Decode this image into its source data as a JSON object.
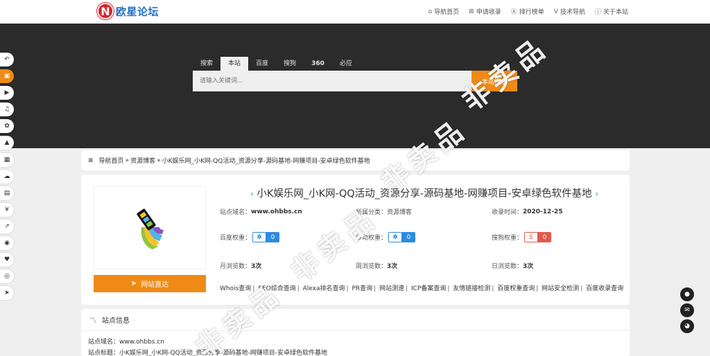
{
  "header": {
    "logo_mark": "N",
    "logo_text": "欧星论坛",
    "nav": [
      {
        "icon": "home-icon",
        "glyph": "⌂",
        "label": "导航首页"
      },
      {
        "icon": "plus-square-icon",
        "glyph": "⊞",
        "label": "申请收录"
      },
      {
        "icon": "ranking-icon",
        "glyph": "Ⓐ",
        "label": "排行榜单"
      },
      {
        "icon": "v-icon",
        "glyph": "V",
        "label": "技术导航"
      },
      {
        "icon": "info-icon",
        "glyph": "ⓘ",
        "label": "关于本站"
      }
    ]
  },
  "search": {
    "tabs": [
      "搜索",
      "本站",
      "百度",
      "搜狗",
      "360",
      "必应"
    ],
    "active_tab": 1,
    "placeholder": "请输入关键词...",
    "button_label": "本站搜索"
  },
  "breadcrumb": {
    "icon": "≡",
    "items": [
      "导航首页",
      "资源博客",
      "小K娱乐网_小K网-QQ活动_资源分享-源码基地-网赚项目-安卓绿色软件基地"
    ],
    "separator": "»"
  },
  "site": {
    "title": "小K娱乐网_小K网-QQ活动_资源分享-源码基地-网赚项目-安卓绿色软件基地",
    "visit_label": "网站直达",
    "domain_label": "站点域名：",
    "domain": "www.ohbbs.cn",
    "category_label": "所属分类：",
    "category": "资源博客",
    "added_label": "收录时间：",
    "added": "2020-12-25",
    "baidu_label": "百度权重：",
    "baidu_value": "0",
    "mobile_label": "移动权重：",
    "mobile_value": "0",
    "sogou_label": "搜狗权重：",
    "sogou_value": "0",
    "monthly_label": "月浏览数：",
    "monthly": "3次",
    "weekly_label": "周浏览数：",
    "weekly": "3次",
    "daily_label": "日浏览数：",
    "daily": "3次",
    "tools": [
      "Whois查询",
      "SEO综合查询",
      "Alexa排名查询",
      "PR查询",
      "网站测速",
      "ICP备案查询",
      "友情链接检测",
      "百度权重查询",
      "网站安全检测",
      "百度收录查询"
    ]
  },
  "info_section": {
    "header": "站点信息",
    "domain_line": "站点域名：www.ohbbs.cn",
    "title_line": "站点标题：小K娱乐网_小K网-QQ活动_资源分享-源码基地-网赚项目-安卓绿色软件基地"
  },
  "watermark": "非卖品",
  "colors": {
    "accent": "#f08a17",
    "hero_bg": "#2b2b2b",
    "baidu_blue": "#2d8be0",
    "sogou_red": "#e05a4b"
  }
}
